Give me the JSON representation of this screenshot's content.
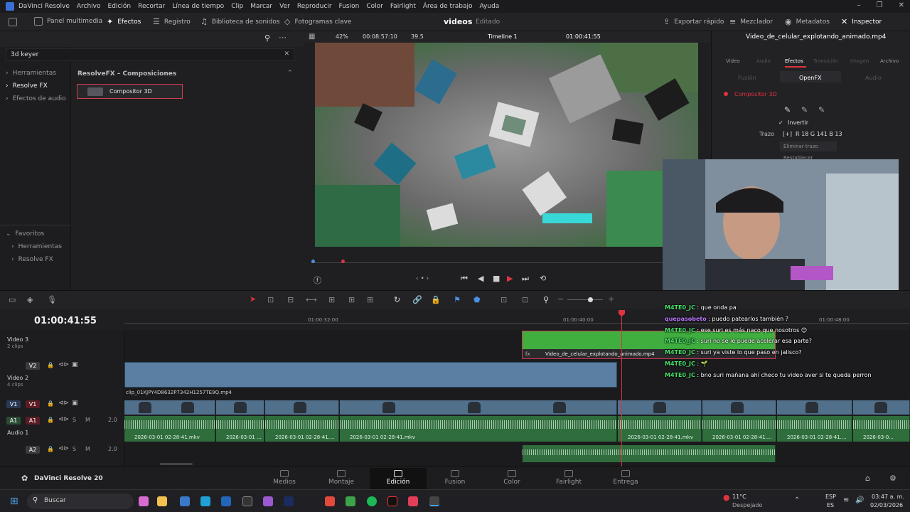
{
  "menubar": {
    "app_name": "DaVinci Resolve",
    "items": [
      "Archivo",
      "Edición",
      "Recortar",
      "Línea de tiempo",
      "Clip",
      "Marcar",
      "Ver",
      "Reproducir",
      "Fusion",
      "Color",
      "Fairlight",
      "Área de trabajo",
      "Ayuda"
    ]
  },
  "toolbar": {
    "media_pool": "Panel multimedia",
    "effects": "Efectos",
    "edit_index": "Registro",
    "sound_library": "Biblioteca de sonidos",
    "keyframes": "Fotogramas clave",
    "project_name": "videos",
    "project_status": "Editado",
    "quick_export": "Exportar rápido",
    "mixer": "Mezclador",
    "metadata": "Metadatos",
    "inspector": "Inspector"
  },
  "effects_panel": {
    "search_value": "3d keyer",
    "nav": [
      "Herramientas",
      "Resolve FX",
      "Efectos de audio"
    ],
    "nav_selected": "Resolve FX",
    "category_title": "ResolveFX – Composiciones",
    "result": "Compositor 3D",
    "favorites_title": "Favoritos",
    "favorites": [
      "Herramientas",
      "Resolve FX"
    ]
  },
  "viewer": {
    "zoom": "42%",
    "source_timecode": "00:08:57:10",
    "fps": "39.5",
    "timeline_name": "Timeline 1",
    "timecode": "01:00:41:55",
    "clip_name": "Video_de_celular_explotando_animado.mp4"
  },
  "inspector": {
    "tabs": [
      "Video",
      "Audio",
      "Efectos",
      "Transición",
      "Imagen",
      "Archivo"
    ],
    "active_tab": "Efectos",
    "subtabs": [
      "Fusión",
      "OpenFX",
      "Audio"
    ],
    "effect_name": "Compositor 3D",
    "invert_label": "Invertir",
    "stroke_label": "Trazo",
    "stroke_value": "R 18  G 141  B 13",
    "remove_stroke": "Eliminar trazo",
    "restore": "Restablecer"
  },
  "timeline": {
    "timecode": "01:00:41:55",
    "ruler": [
      "01:00:32:00",
      "01:00:40:00",
      "01:00:48:00"
    ],
    "tracks": {
      "v3": {
        "name": "Video 3",
        "clips": "2 clips"
      },
      "v2": {
        "badge": "V2",
        "name": "Video 2",
        "clips": "4 clips"
      },
      "v1": {
        "badge": "V1"
      },
      "a1": {
        "badge": "A1",
        "name": "Audio 1",
        "level": "2.0"
      },
      "a2": {
        "badge": "A2",
        "level": "2.0"
      }
    },
    "v3_clip": "Video_de_celular_explotando_animado.mp4",
    "v2_clip": "clip_01KJPY4D8632P7342H1257TE9Q.mp4",
    "audio_clips": [
      "2026-03-01 02-28-41.mkv",
      "2026-03-01 ...",
      "2026-03-01 02-28-41....",
      "2026-03-01 02-28-41.mkv",
      "2026-03-01 02-28-41.mkv",
      "2026-03-01 02-28-41....",
      "2026-03-01 02-28-41....",
      "2026-03-0..."
    ]
  },
  "chat": [
    {
      "user": "M4TE0_JC",
      "color": "#48e06a",
      "text": "que onda pa"
    },
    {
      "user": "quepasobeto",
      "color": "#b978ff",
      "text": "puedo patearlos también ?"
    },
    {
      "user": "M4TE0_JC",
      "color": "#48e06a",
      "text": "ese suri es más naco que nosotros 😊"
    },
    {
      "user": "M4TE0_JC",
      "color": "#48e06a",
      "text": "suri no se le puede acelerar esa parte?"
    },
    {
      "user": "M4TE0_JC",
      "color": "#48e06a",
      "text": "suri ya viste lo que paso en jalisco?"
    },
    {
      "user": "M4TE0_JC",
      "color": "#48e06a",
      "text": "🌱"
    },
    {
      "user": "M4TE0_JC",
      "color": "#48e06a",
      "text": "bno suri mañana ahí checo tu video aver si te queda perron"
    }
  ],
  "bottom": {
    "brand": "DaVinci Resolve 20",
    "pages": [
      "Medios",
      "Montaje",
      "Edición",
      "Fusion",
      "Color",
      "Fairlight",
      "Entrega"
    ],
    "active_page": "Edición"
  },
  "taskbar": {
    "search_placeholder": "Buscar",
    "weather_temp": "11°C",
    "weather_desc": "Despejado",
    "lang": "ESP",
    "region": "ES",
    "time": "03:47 a. m.",
    "date": "02/03/2026"
  },
  "colors": {
    "accent_red": "#e0323f",
    "audio_green": "#2f6d3d",
    "video_blue": "#5a7fa2",
    "v3_green": "#3fae3f"
  }
}
